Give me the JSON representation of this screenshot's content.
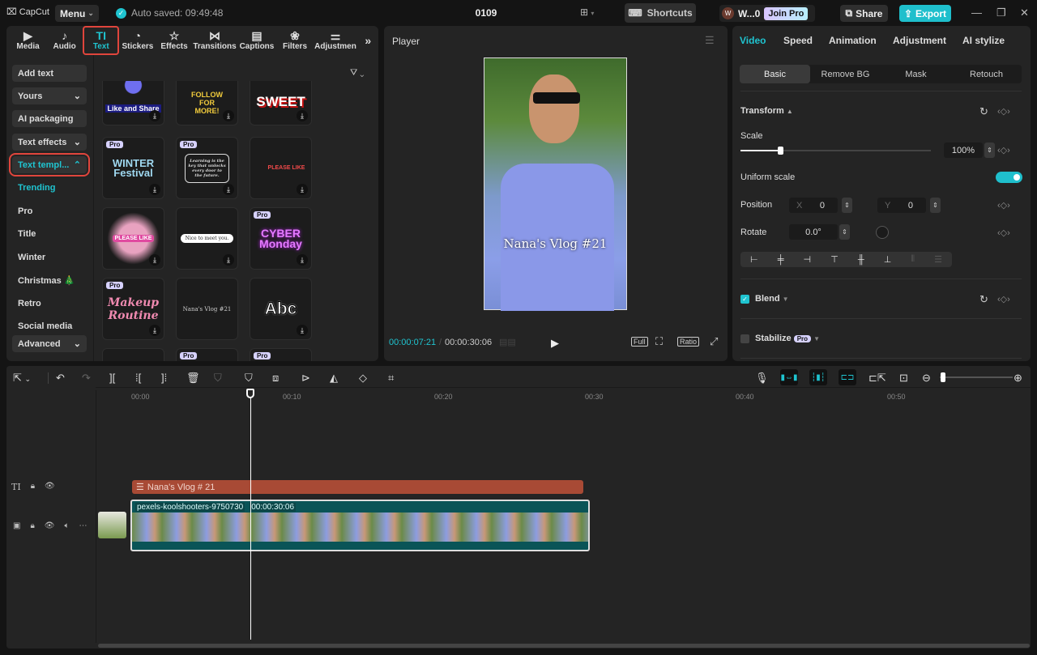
{
  "titlebar": {
    "app_name": "CapCut",
    "menu_label": "Menu",
    "autosave": "Auto saved: 09:49:48",
    "project_title": "0109",
    "shortcuts_label": "Shortcuts",
    "user_initial": "W",
    "user_name": "W...0",
    "join_pro": "Join Pro",
    "share_label": "Share",
    "export_label": "Export"
  },
  "media_tabs": [
    {
      "icon": "media-icon",
      "glyph": "▶",
      "label": "Media"
    },
    {
      "icon": "audio-icon",
      "glyph": "♪",
      "label": "Audio"
    },
    {
      "icon": "text-icon",
      "glyph": "TI",
      "label": "Text"
    },
    {
      "icon": "stickers-icon",
      "glyph": "◔",
      "label": "Stickers"
    },
    {
      "icon": "effects-icon",
      "glyph": "☆",
      "label": "Effects"
    },
    {
      "icon": "transitions-icon",
      "glyph": "⋈",
      "label": "Transitions"
    },
    {
      "icon": "captions-icon",
      "glyph": "▤",
      "label": "Captions"
    },
    {
      "icon": "filters-icon",
      "glyph": "❀",
      "label": "Filters"
    },
    {
      "icon": "adjustment-icon",
      "glyph": "⚌",
      "label": "Adjustmen"
    }
  ],
  "more_tabs": "»",
  "sidebar": {
    "buttons": [
      {
        "label": "Add text",
        "chevron": ""
      },
      {
        "label": "Yours",
        "chevron": "⌄"
      },
      {
        "label": "AI packaging",
        "chevron": ""
      },
      {
        "label": "Text effects",
        "chevron": "⌄"
      },
      {
        "label": "Text templ...",
        "chevron": "⌃"
      }
    ],
    "items": [
      "Trending",
      "Pro",
      "Title",
      "Winter",
      "Christmas 🎄",
      "Retro",
      "Social media"
    ],
    "advanced": {
      "label": "Advanced",
      "chevron": "⌄"
    }
  },
  "templates": [
    {
      "name": "Like and Share",
      "pro": false
    },
    {
      "name": "FOLLOW FOR MORE!",
      "pro": false
    },
    {
      "name": "SWEET",
      "pro": false
    },
    {
      "name": "WINTER Festival",
      "pro": true
    },
    {
      "name": "Learning is the key that unlocks every door to the future.",
      "pro": true
    },
    {
      "name": "PLEASE LIKE",
      "pro": false
    },
    {
      "name": "PLEASE LIKE",
      "pro": false
    },
    {
      "name": "Nice to meet you.",
      "pro": false
    },
    {
      "name": "CYBER Monday",
      "pro": true
    },
    {
      "name": "Makeup Routine",
      "pro": true
    },
    {
      "name": "Nana's Vlog #21",
      "pro": false
    },
    {
      "name": "Abc",
      "pro": false
    },
    {
      "name": "",
      "pro": false
    },
    {
      "name": "",
      "pro": true
    },
    {
      "name": "",
      "pro": true
    }
  ],
  "pro_badge": "Pro",
  "player": {
    "title": "Player",
    "overlay_text": "Nana's  Vlog  #21",
    "current_time": "00:00:07:21",
    "separator": "/",
    "total_time": "00:00:30:06",
    "full_label": "Full",
    "ratio_label": "Ratio"
  },
  "inspector": {
    "tabs": [
      "Video",
      "Speed",
      "Animation",
      "Adjustment",
      "AI stylize"
    ],
    "subtabs": [
      "Basic",
      "Remove BG",
      "Mask",
      "Retouch"
    ],
    "transform_label": "Transform",
    "scale_label": "Scale",
    "scale_value": "100%",
    "scale_slider_fraction": 0.21,
    "uniform_scale_label": "Uniform scale",
    "uniform_scale_on": true,
    "position_label": "Position",
    "pos_x_label": "X",
    "pos_x": "0",
    "pos_y_label": "Y",
    "pos_y": "0",
    "rotate_label": "Rotate",
    "rotate_value": "0.0°",
    "blend_label": "Blend",
    "blend_checked": true,
    "stabilize_label": "Stabilize",
    "stabilize_checked": false
  },
  "timeline": {
    "ruler_ticks": [
      "00:00",
      "00:10",
      "00:20",
      "00:30",
      "00:40",
      "00:50"
    ],
    "text_clip": "Nana's  Vlog  # 21",
    "video_clip_name": "pexels-koolshooters-9750730",
    "video_clip_duration": "00:00:30:06"
  },
  "colors": {
    "accent": "#1fc4d0",
    "highlight": "#e0453c",
    "text_clip": "#a84a35",
    "video_clip": "#0a5457"
  }
}
